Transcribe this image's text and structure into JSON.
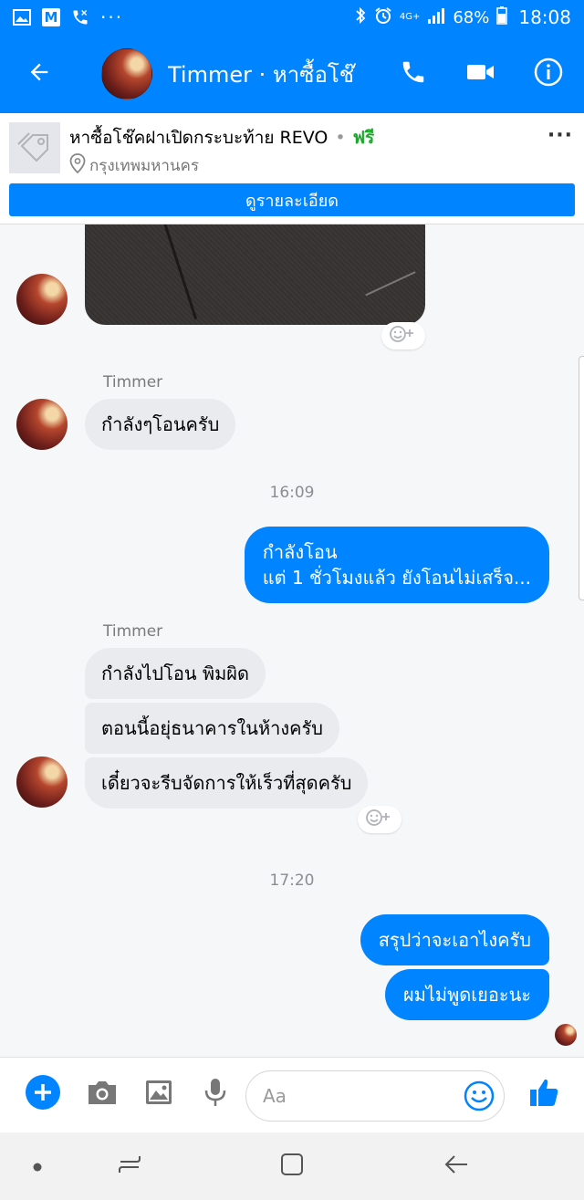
{
  "status_bar": {
    "battery": "68%",
    "time": "18:08",
    "network": "4G+",
    "icons": [
      "gallery-icon",
      "gmail-icon",
      "missed-call-icon",
      "more-notifications-icon",
      "bluetooth-icon",
      "alarm-icon",
      "signal-icon",
      "battery-icon"
    ]
  },
  "header": {
    "title": "Timmer · หาซื้อโช๊",
    "back_icon": "arrow-back-icon",
    "call_icon": "phone-icon",
    "video_icon": "video-camera-icon",
    "info_icon": "info-icon"
  },
  "product": {
    "title": "หาซื้อโช๊คฝาเปิดกระบะท้าย REVO",
    "separator": "•",
    "price": "ฟรี",
    "location": "กรุงเทพมหานคร",
    "more": "···",
    "details_button": "ดูรายละเอียด"
  },
  "messages": {
    "sender_1": "Timmer",
    "in_1": "กำลังๆโอนครับ",
    "time_1": "16:09",
    "out_1_line1": "กำลังโอน",
    "out_1_line2": "แต่ 1 ชั่วโมงแล้ว ยังโอนไม่เสร็จ...",
    "sender_2": "Timmer",
    "in_2": "กำลังไปโอน พิมผิด",
    "in_3": "ตอนนี้อยุ่ธนาคารในห้างครับ",
    "in_4": "เดี๋ยวจะรีบจัดการให้เร็วที่สุดครับ",
    "time_2": "17:20",
    "out_2": "สรุปว่าจะเอาไงครับ",
    "out_3": "ผมไม่พูดเยอะนะ"
  },
  "composer": {
    "placeholder": "Aa"
  },
  "colors": {
    "accent": "#0084ff",
    "incoming_bubble": "#e9ebee",
    "price": "#1ca82b"
  }
}
